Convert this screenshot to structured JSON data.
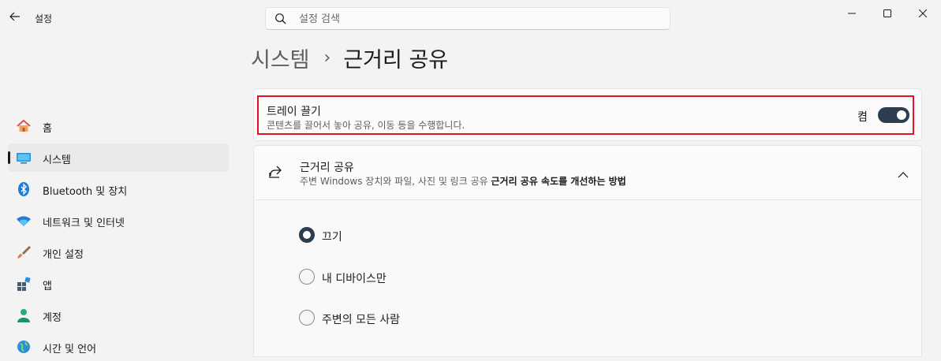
{
  "app": {
    "title": "설정"
  },
  "search": {
    "placeholder": "설정 검색"
  },
  "breadcrumb": {
    "parent": "시스템",
    "separator": "›",
    "current": "근거리 공유"
  },
  "sidebar": {
    "items": [
      {
        "label": "홈",
        "icon": "home-icon"
      },
      {
        "label": "시스템",
        "icon": "system-icon",
        "selected": true
      },
      {
        "label": "Bluetooth 및 장치",
        "icon": "bluetooth-icon"
      },
      {
        "label": "네트워크 및 인터넷",
        "icon": "wifi-icon"
      },
      {
        "label": "개인 설정",
        "icon": "brush-icon"
      },
      {
        "label": "앱",
        "icon": "apps-icon"
      },
      {
        "label": "계정",
        "icon": "account-icon"
      },
      {
        "label": "시간 및 언어",
        "icon": "globe-icon"
      }
    ]
  },
  "tray_drag": {
    "title": "트레이 끌기",
    "description": "콘텐츠를 끌어서 놓아 공유, 이동 등을 수행합니다.",
    "state_label": "켬",
    "enabled": true
  },
  "nearby_share": {
    "title": "근거리 공유",
    "description": "주변 Windows 장치와 파일, 사진 및 링크 공유",
    "link": "근거리 공유 속도를 개선하는 방법",
    "expanded": true,
    "options": [
      {
        "label": "끄기",
        "selected": true
      },
      {
        "label": "내 디바이스만",
        "selected": false
      },
      {
        "label": "주변의 모든 사람",
        "selected": false
      }
    ]
  },
  "colors": {
    "accent": "#2b3d4f",
    "highlight": "#e81123"
  }
}
